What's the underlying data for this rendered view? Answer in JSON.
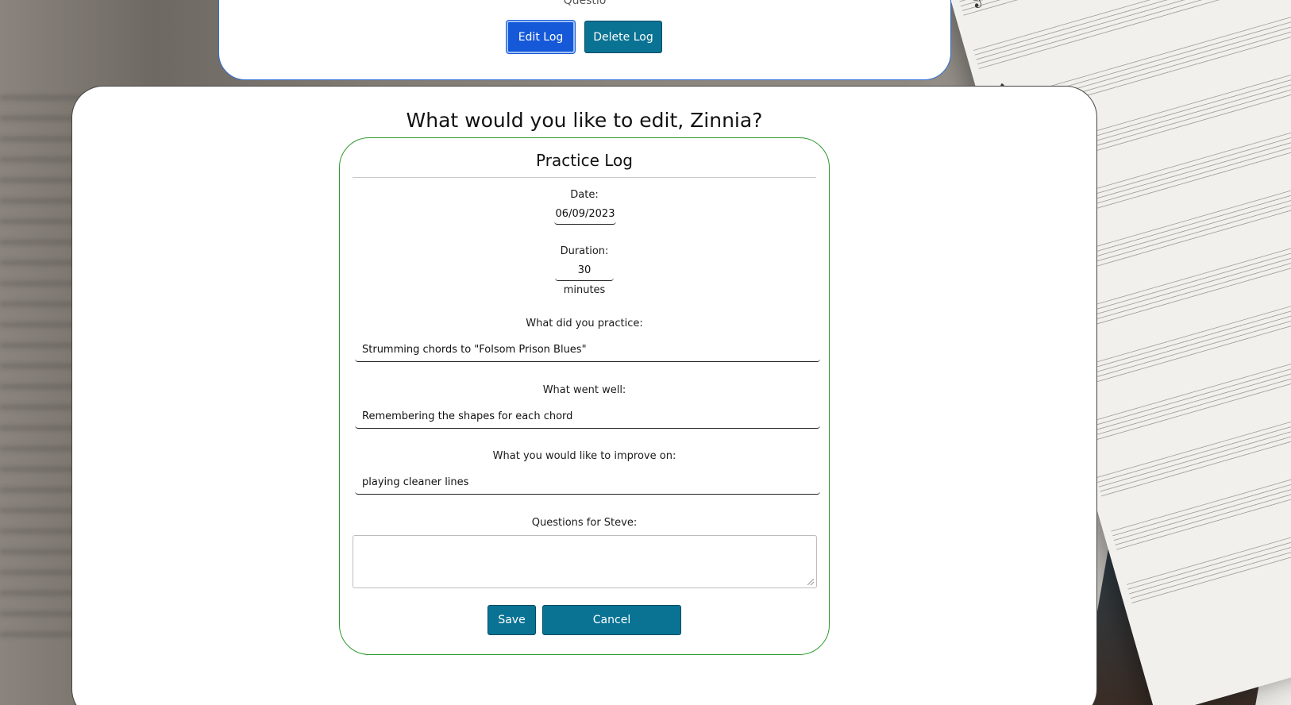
{
  "top_card": {
    "partial_text": "Questio",
    "edit_label": "Edit Log",
    "delete_label": "Delete Log"
  },
  "main": {
    "heading": "What would you like to edit, Zinnia?"
  },
  "form": {
    "title": "Practice Log",
    "date_label": "Date:",
    "date_value": "06/09/2023",
    "duration_label": "Duration:",
    "duration_value": "30",
    "duration_unit": "minutes",
    "practiced_label": "What did you practice:",
    "practiced_value": "Strumming chords to \"Folsom Prison Blues\"",
    "went_well_label": "What went well:",
    "went_well_value": "Remembering the shapes for each chord",
    "improve_label": "What you would like to improve on:",
    "improve_value": "playing cleaner lines",
    "questions_label": "Questions for Steve:",
    "questions_value": "",
    "save_label": "Save",
    "cancel_label": "Cancel"
  },
  "colors": {
    "primary_button": "#0a7394",
    "active_button": "#1559d8",
    "form_border": "#2e9a2e",
    "top_card_border": "#2c6fd6"
  }
}
